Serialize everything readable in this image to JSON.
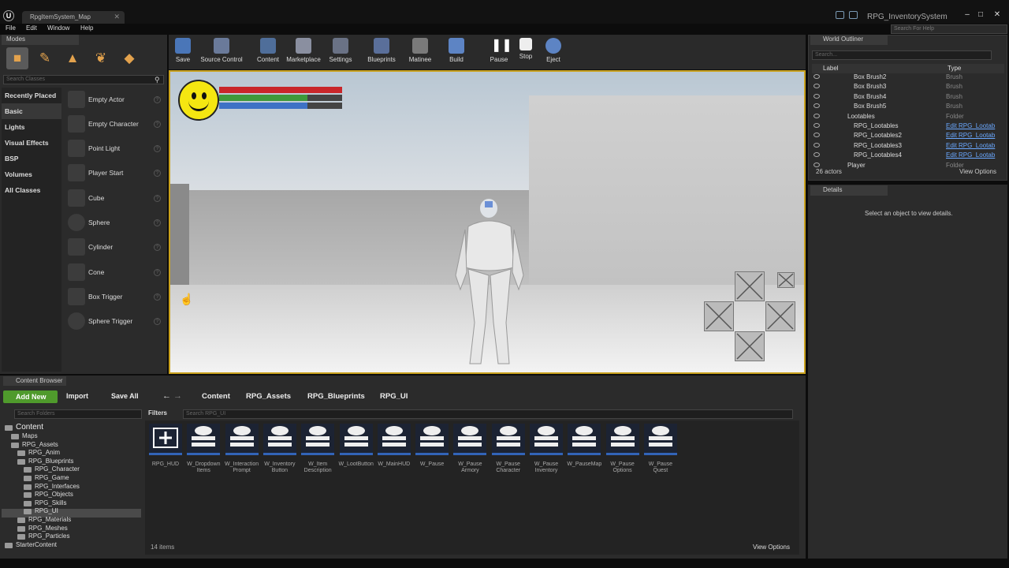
{
  "window": {
    "tab_title": "RpgItemSystem_Map",
    "project_title": "RPG_InventorySystem",
    "help_search_placeholder": "Search For Help"
  },
  "menu": [
    "File",
    "Edit",
    "Window",
    "Help"
  ],
  "modes": {
    "tab_label": "Modes",
    "search_placeholder": "Search Classes",
    "categories": [
      "Recently Placed",
      "Basic",
      "Lights",
      "Visual Effects",
      "BSP",
      "Volumes",
      "All Classes"
    ],
    "selected_category": "Basic",
    "items": [
      "Empty Actor",
      "Empty Character",
      "Point Light",
      "Player Start",
      "Cube",
      "Sphere",
      "Cylinder",
      "Cone",
      "Box Trigger",
      "Sphere Trigger"
    ]
  },
  "toolbar": [
    "Save",
    "Source Control",
    "Content",
    "Marketplace",
    "Settings",
    "Blueprints",
    "Matinee",
    "Build",
    "Pause",
    "Stop",
    "Eject"
  ],
  "hud": {
    "health": 1.0,
    "stamina": 0.72,
    "mana": 0.72,
    "health_color": "#c9262a",
    "stamina_color": "#3e9a3a",
    "mana_color": "#3e72c5"
  },
  "outliner": {
    "tab_label": "World Outliner",
    "search_placeholder": "Search...",
    "columns": [
      "Label",
      "Type"
    ],
    "rows": [
      {
        "label": "Box Brush2",
        "type": "Brush"
      },
      {
        "label": "Box Brush3",
        "type": "Brush"
      },
      {
        "label": "Box Brush4",
        "type": "Brush"
      },
      {
        "label": "Box Brush5",
        "type": "Brush"
      },
      {
        "label": "Lootables",
        "type": "Folder"
      },
      {
        "label": "RPG_Lootables",
        "type": "Edit RPG_Lootab"
      },
      {
        "label": "RPG_Lootables2",
        "type": "Edit RPG_Lootab"
      },
      {
        "label": "RPG_Lootables3",
        "type": "Edit RPG_Lootab"
      },
      {
        "label": "RPG_Lootables4",
        "type": "Edit RPG_Lootab"
      },
      {
        "label": "Player",
        "type": "Folder"
      }
    ],
    "footer": "26 actors",
    "view_options": "View Options"
  },
  "details": {
    "tab_label": "Details",
    "message": "Select an object to view details."
  },
  "content_browser": {
    "tab_label": "Content Browser",
    "add_new": "Add New",
    "import": "Import",
    "save_all": "Save All",
    "breadcrumb": [
      "Content",
      "RPG_Assets",
      "RPG_Blueprints",
      "RPG_UI"
    ],
    "folder_search_placeholder": "Search Folders",
    "asset_search_placeholder": "Search RPG_UI",
    "filters": "Filters",
    "tree": [
      "Content",
      "Maps",
      "RPG_Assets",
      "RPG_Anim",
      "RPG_Blueprints",
      "RPG_Character",
      "RPG_Game",
      "RPG_Interfaces",
      "RPG_Objects",
      "RPG_Skills",
      "RPG_UI",
      "RPG_Materials",
      "RPG_Meshes",
      "RPG_Particles",
      "StarterContent"
    ],
    "assets": [
      "RPG_HUD",
      "W_Dropdown Items",
      "W_Interaction Prompt",
      "W_Inventory Button",
      "W_Item Description",
      "W_LootButton",
      "W_MainHUD",
      "W_Pause",
      "W_Pause Armory",
      "W_Pause Character",
      "W_Pause Inventory",
      "W_PauseMap",
      "W_Pause Options",
      "W_Pause Quest"
    ],
    "item_count": "14 items",
    "view_options": "View Options"
  }
}
